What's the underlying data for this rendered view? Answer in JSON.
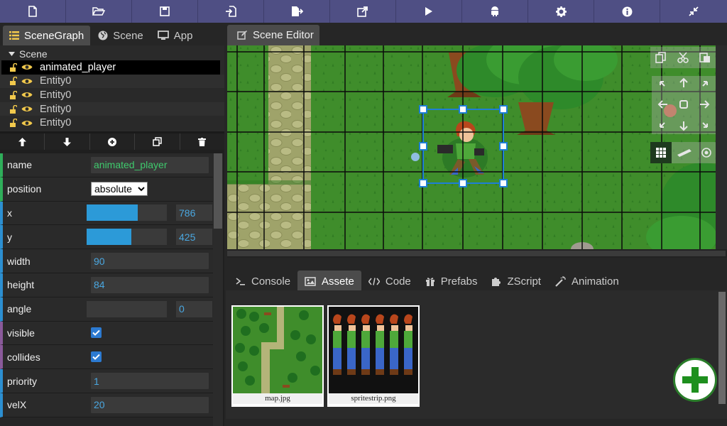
{
  "toolbar": {
    "buttons": [
      "new-file",
      "open-folder",
      "save",
      "import",
      "export",
      "share",
      "play",
      "android",
      "settings",
      "info",
      "compress"
    ]
  },
  "left_tabs": [
    {
      "label": "SceneGraph",
      "icon": "list-icon",
      "active": true
    },
    {
      "label": "Scene",
      "icon": "globe-icon",
      "active": false
    },
    {
      "label": "App",
      "icon": "monitor-icon",
      "active": false
    }
  ],
  "tree": {
    "root": "Scene",
    "items": [
      "animated_player",
      "Entity0",
      "Entity0",
      "Entity0",
      "Entity0"
    ]
  },
  "props": {
    "name": {
      "label": "name",
      "value": "animated_player"
    },
    "position": {
      "label": "position",
      "value": "absolute",
      "options": [
        "absolute"
      ]
    },
    "x": {
      "label": "x",
      "value": "786",
      "fill": 0.64
    },
    "y": {
      "label": "y",
      "value": "425",
      "fill": 0.56
    },
    "width": {
      "label": "width",
      "value": "90"
    },
    "height": {
      "label": "height",
      "value": "84"
    },
    "angle": {
      "label": "angle",
      "value": "0",
      "fill": 0
    },
    "visible": {
      "label": "visible",
      "checked": true
    },
    "collides": {
      "label": "collides",
      "checked": true
    },
    "priority": {
      "label": "priority",
      "value": "1"
    },
    "velX": {
      "label": "velX",
      "value": "20"
    }
  },
  "scene_editor": {
    "tab_label": "Scene Editor"
  },
  "bottom_tabs": [
    {
      "label": "Console",
      "icon": "terminal-icon",
      "active": false
    },
    {
      "label": "Assete",
      "icon": "image-icon",
      "active": true
    },
    {
      "label": "Code",
      "icon": "code-icon",
      "active": false
    },
    {
      "label": "Prefabs",
      "icon": "gift-icon",
      "active": false
    },
    {
      "label": "ZScript",
      "icon": "puzzle-icon",
      "active": false
    },
    {
      "label": "Animation",
      "icon": "wand-icon",
      "active": false
    }
  ],
  "assets": [
    {
      "caption": "map.jpg"
    },
    {
      "caption": "spritestrip.png"
    }
  ],
  "colors": {
    "toolbar": "#4f4f84",
    "accent": "#2c9ad8",
    "selection_handle": "#1e7fd6",
    "add_button": "#1e8f1e"
  }
}
